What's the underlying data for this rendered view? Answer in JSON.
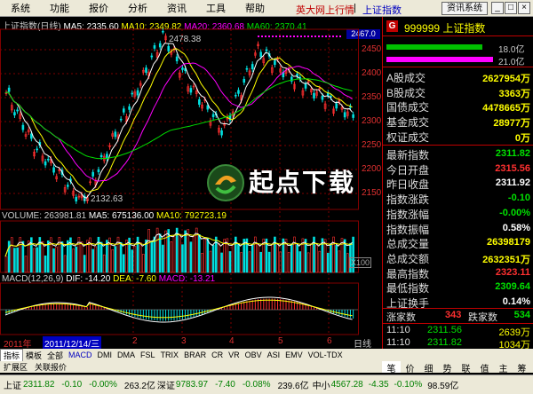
{
  "menu": [
    "系统",
    "功能",
    "报价",
    "分析",
    "资讯",
    "工具",
    "帮助"
  ],
  "marquee": "英大网上行情",
  "marquee_sep": "|",
  "marquee_index": "上证指数",
  "sys_button": "资讯系统",
  "window_buttons": [
    "_",
    "□",
    "×"
  ],
  "main_info": {
    "title": "上证指数(日线)",
    "ma5": "MA5: 2335.60",
    "ma10": "MA10: 2349.82",
    "ma20": "MA20: 2360.68",
    "ma60": "MA60: 2370.41"
  },
  "price_box": "2467.0",
  "price_y_labels": [
    "2450",
    "2400",
    "2350",
    "2300",
    "2250",
    "2200",
    "2150"
  ],
  "high_marker": "2478.38",
  "low_marker": "←2132.63",
  "volume_info": {
    "vol": "VOLUME: 263981.81",
    "ma5": "MA5: 675136.00",
    "ma10": "MA10: 792723.19"
  },
  "volume_y_labels": [
    "",
    "",
    ""
  ],
  "volume_unit": "X100",
  "macd_info": {
    "title": "MACD(12,26,9)",
    "dif": "DIF: -14.20",
    "dea": "DEA: -7.60",
    "macd": "MACD: -13.21"
  },
  "macd_y_labels": [
    "",
    "",
    "",
    ""
  ],
  "date_row": {
    "year": "2011年",
    "selected": "2011/12/14/三",
    "nums": [
      "2",
      "3",
      "4",
      "5",
      "6"
    ],
    "period": "日线"
  },
  "tabs": [
    "指标",
    "模板",
    "全部",
    "MACD",
    "DMI",
    "DMA",
    "FSL",
    "TRIX",
    "BRAR",
    "CR",
    "VR",
    "OBV",
    "ASI",
    "EMV",
    "VOL-TDX"
  ],
  "tabs2": [
    "扩展区",
    "关联报价"
  ],
  "right_tabs": [
    "笔",
    "价",
    "细",
    "势",
    "联",
    "值",
    "主",
    "筹"
  ],
  "quote": {
    "badge": "G",
    "code_name": "999999 上证指数",
    "bar1_val": "18.0亿",
    "bar2_val": "21.0亿",
    "rows1": [
      {
        "label": "A股成交",
        "value": "2627954万",
        "color": "#ffff00"
      },
      {
        "label": "B股成交",
        "value": "3363万",
        "color": "#ffff00"
      },
      {
        "label": "国债成交",
        "value": "4478665万",
        "color": "#ffff00"
      },
      {
        "label": "基金成交",
        "value": "28977万",
        "color": "#ffff00"
      },
      {
        "label": "权证成交",
        "value": "0万",
        "color": "#ffff00"
      }
    ],
    "rows2": [
      {
        "label": "最新指数",
        "value": "2311.82",
        "color": "#00e000"
      },
      {
        "label": "今日开盘",
        "value": "2315.56",
        "color": "#ff3030"
      },
      {
        "label": "昨日收盘",
        "value": "2311.92",
        "color": "#ffffff"
      },
      {
        "label": "指数涨跌",
        "value": "-0.10",
        "color": "#00e000"
      },
      {
        "label": "指数涨幅",
        "value": "-0.00%",
        "color": "#00e000"
      },
      {
        "label": "指数振幅",
        "value": "0.58%",
        "color": "#ffffff"
      },
      {
        "label": "总成交量",
        "value": "26398179",
        "color": "#ffff00"
      },
      {
        "label": "总成交额",
        "value": "2632351万",
        "color": "#ffff00"
      },
      {
        "label": "最高指数",
        "value": "2323.11",
        "color": "#ff3030"
      },
      {
        "label": "最低指数",
        "value": "2309.64",
        "color": "#00e000"
      },
      {
        "label": "上证换手",
        "value": "0.14%",
        "color": "#ffffff"
      }
    ],
    "rise_label": "涨家数",
    "rise_val": "343",
    "fall_label": "跌家数",
    "fall_val": "534",
    "ticks": [
      {
        "time": "11:10",
        "price": "2311.56",
        "vol": "2639万"
      },
      {
        "time": "11:10",
        "price": "2311.82",
        "vol": "1034万"
      }
    ]
  },
  "status": {
    "sh_label": "上证",
    "sh_val": "2311.82",
    "sh_chg": "-0.10",
    "sh_pct": "-0.00%",
    "sh_amt": "263.2亿",
    "sz_label": "深证",
    "sz_val": "9783.97",
    "sz_chg": "-7.40",
    "sz_pct": "-0.08%",
    "sz_amt": "239.6亿",
    "zx_label": "中小",
    "zx_val": "4567.28",
    "zx_chg": "-4.35",
    "zx_pct": "-0.10%",
    "zx_amt": "98.59亿"
  },
  "logo_text": "起点下载",
  "colors": {
    "ma5": "#ffffff",
    "ma10": "#ffff00",
    "ma20": "#ff00ff",
    "ma60": "#00e000",
    "up": "#ff3030",
    "down": "#00e0e0",
    "grid": "#800000"
  }
}
